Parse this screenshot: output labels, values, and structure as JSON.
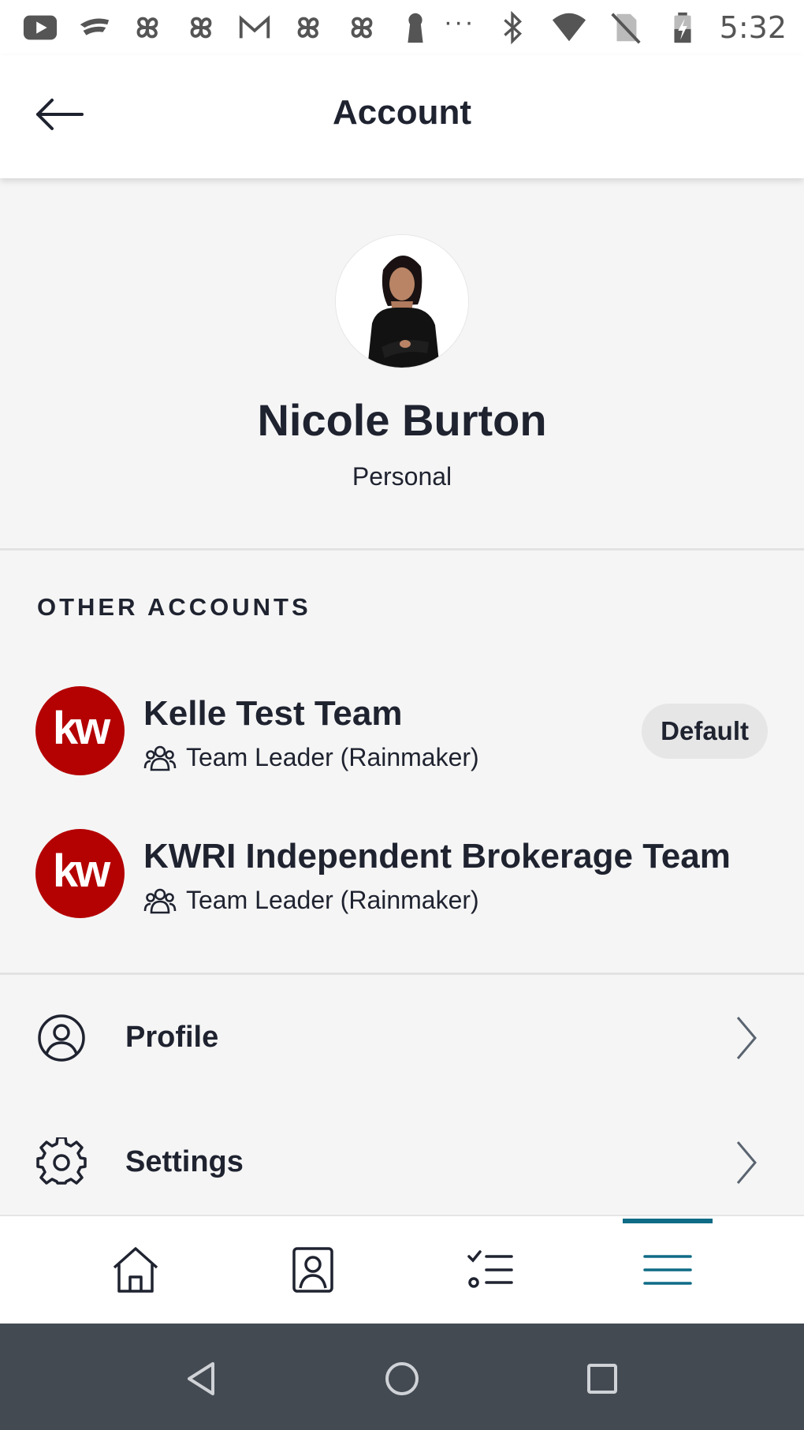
{
  "status_bar": {
    "time": "5:32",
    "overflow": "···",
    "left_icons": [
      "youtube-icon",
      "stadia-icon",
      "pinwheel-icon",
      "pinwheel-icon",
      "gmail-icon",
      "pinwheel-icon",
      "pinwheel-icon",
      "keyhole-icon"
    ],
    "right_icons": [
      "bluetooth-icon",
      "wifi-icon",
      "no-sim-icon",
      "battery-charging-icon"
    ]
  },
  "header": {
    "title": "Account"
  },
  "profile": {
    "name": "Nicole Burton",
    "account_type": "Personal"
  },
  "other_accounts": {
    "section_label": "OTHER ACCOUNTS",
    "items": [
      {
        "logo_text": "kw",
        "name": "Kelle Test Team",
        "role": "Team Leader (Rainmaker)",
        "badge": "Default"
      },
      {
        "logo_text": "kw",
        "name": "KWRI Independent Brokerage Team",
        "role": "Team Leader (Rainmaker)"
      }
    ]
  },
  "menu": {
    "items": [
      {
        "label": "Profile",
        "icon": "user-circle-icon"
      },
      {
        "label": "Settings",
        "icon": "gear-icon"
      }
    ]
  },
  "bottom_nav": {
    "items": [
      "home-icon",
      "contacts-icon",
      "tasks-icon",
      "menu-icon"
    ],
    "active": "menu-icon"
  },
  "colors": {
    "brand_red": "#b40101",
    "accent_teal": "#0f6b86",
    "text_dark": "#1f2330",
    "background": "#f5f5f5"
  }
}
